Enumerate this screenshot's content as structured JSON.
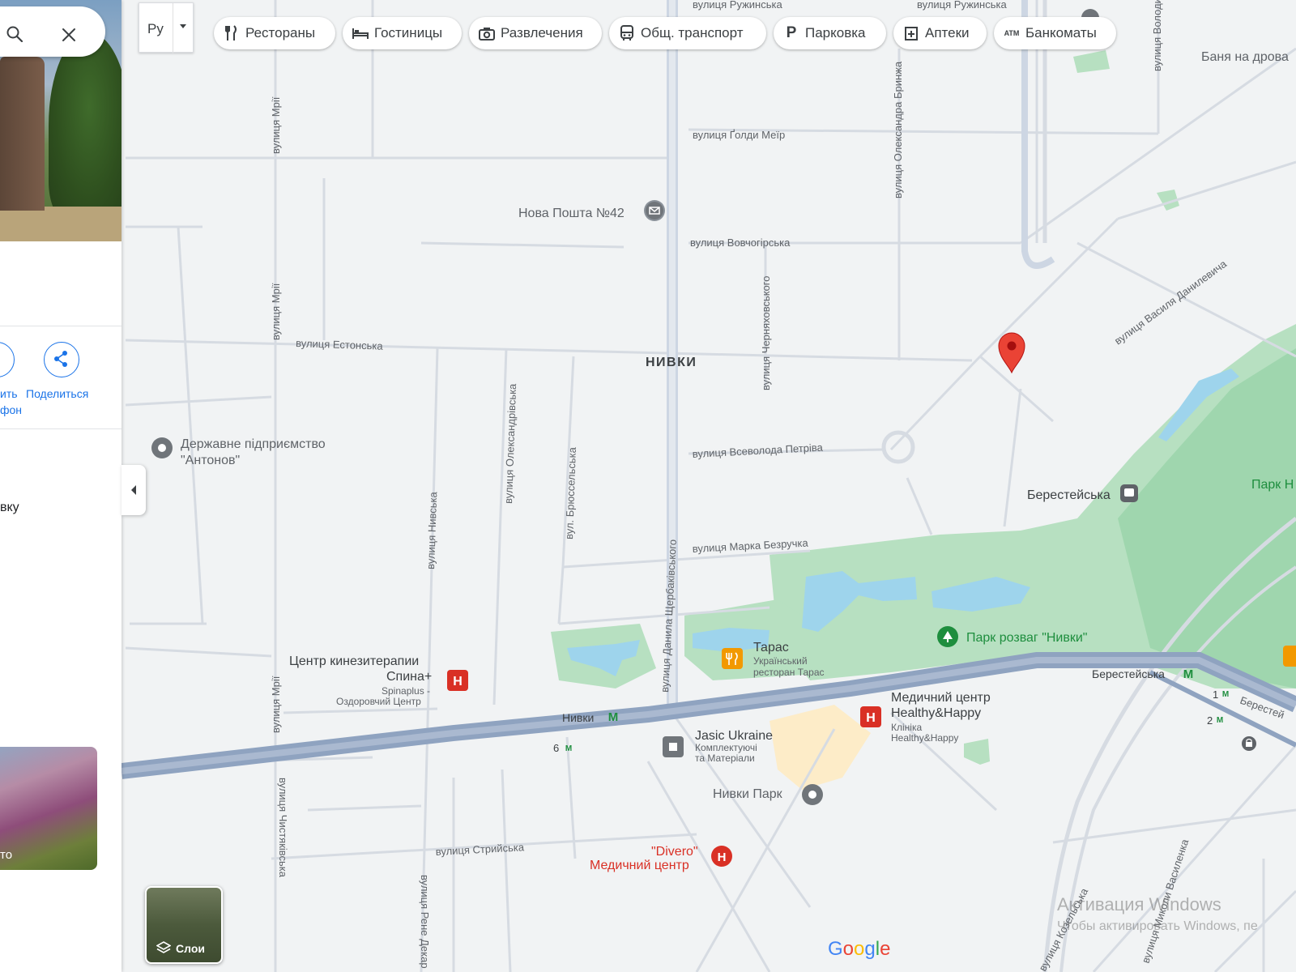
{
  "top_bar": {
    "language": "Ру",
    "chips": [
      {
        "label": "Рестораны",
        "icon": "fork-knife-icon"
      },
      {
        "label": "Гостиницы",
        "icon": "bed-icon"
      },
      {
        "label": "Развлечения",
        "icon": "camera-icon"
      },
      {
        "label": "Общ. транспорт",
        "icon": "bus-icon"
      },
      {
        "label": "Парковка",
        "icon": "parking-icon"
      },
      {
        "label": "Аптеки",
        "icon": "pharmacy-icon"
      },
      {
        "label": "Банкоматы",
        "icon": "atm-icon"
      }
    ]
  },
  "side_panel": {
    "share_label": "Поделиться",
    "partial_button_label_1": "ить",
    "partial_button_label_2": "фон",
    "partial_text": "вку",
    "photo_label": "то"
  },
  "map": {
    "streets": {
      "ruzhynska_1": "вулиця Ружинська",
      "ruzhynska_2": "вулиця Ружинська",
      "goldy_meir": "вулиця Ґолди Меїр",
      "vovchohirska": "вулиця Вовчогірська",
      "estonska": "вулиця Естонська",
      "vsevoloda_petriva": "вулиця Всеволода Петріва",
      "marka_bezruchka": "вулиця Марка Безручка",
      "striyska": "вулиця Стрийська",
      "mrii_1": "вулиця Мрії",
      "mrii_2": "вулиця Мрії",
      "mrii_3": "вулиця Мрії",
      "oleksandra_brynzha": "вулиця Олександра Бринжа",
      "chernyakhovskoho": "вулиця Черняховського",
      "oleksandrivska": "вулиця Олександрівська",
      "bryusselska": "вул. Брюссельська",
      "nyvska": "вулиця Нивська",
      "danyla_shcherbakivskoho": "вулиця Данила Щербаківського",
      "vasylya_danylevycha": "вулиця Василя Данилевича",
      "mykoly_vasylenka": "вулиця Миколи Василенка",
      "chystyakivska": "вулиця Чистяківська",
      "rene_dekarta": "вулиця Рене Декар",
      "volodymyra": "вулиця Володими",
      "kozelska": "вулиця Козельська",
      "berestey_road": "Берестей"
    },
    "district": "НИВКИ",
    "places": {
      "nova_poshta": "Нова Пошта №42",
      "antonov_1": "Державне підприємство",
      "antonov_2": "\"Антонов\"",
      "spyna_1": "Центр кинезитерапии",
      "spyna_2": "Спина+",
      "spyna_3": "Spinaplus -",
      "spyna_4": "Оздоровчий Центр",
      "taras": "Тарас",
      "taras_sub_1": "Український",
      "taras_sub_2": "ресторан Тарас",
      "park_nyvky": "Парк розваг \"Нивки\"",
      "park_partial": "Парк Н",
      "healthy_1": "Медичний центр",
      "healthy_2": "Healthy&Happy",
      "healthy_3": "Клініка",
      "healthy_4": "Healthy&Happy",
      "jasic_1": "Jasic Ukraine",
      "jasic_2": "Комплектуючі",
      "jasic_3": "та Матеріали",
      "nyvky_park": "Нивки Парк",
      "divero_1": "\"Divero\"",
      "divero_2": "Медичний центр",
      "banya": "Баня на дрова",
      "beresteiska_bus": "Берестейська"
    },
    "metro": {
      "nyvky": "Нивки",
      "beresteiska": "Берестейська",
      "exit_6": "6",
      "exit_1": "1",
      "exit_2": "2"
    },
    "colors": {
      "background": "#f1f3f4",
      "road": "#ffffff",
      "major_road": "#cdd6e3",
      "rail": "#8fa3c0",
      "park": "#a8dab5",
      "water": "#9ed4ec",
      "pin": "#ea4335",
      "poi_gray": "#70757a",
      "poi_red": "#d93025",
      "poi_orange": "#f29900",
      "poi_green": "#1e8e3e"
    }
  },
  "layers_label": "Слои",
  "watermark": {
    "line1": "Активация Windows",
    "line2": "Чтобы активировать Windows, пе"
  },
  "google_logo": "Google"
}
